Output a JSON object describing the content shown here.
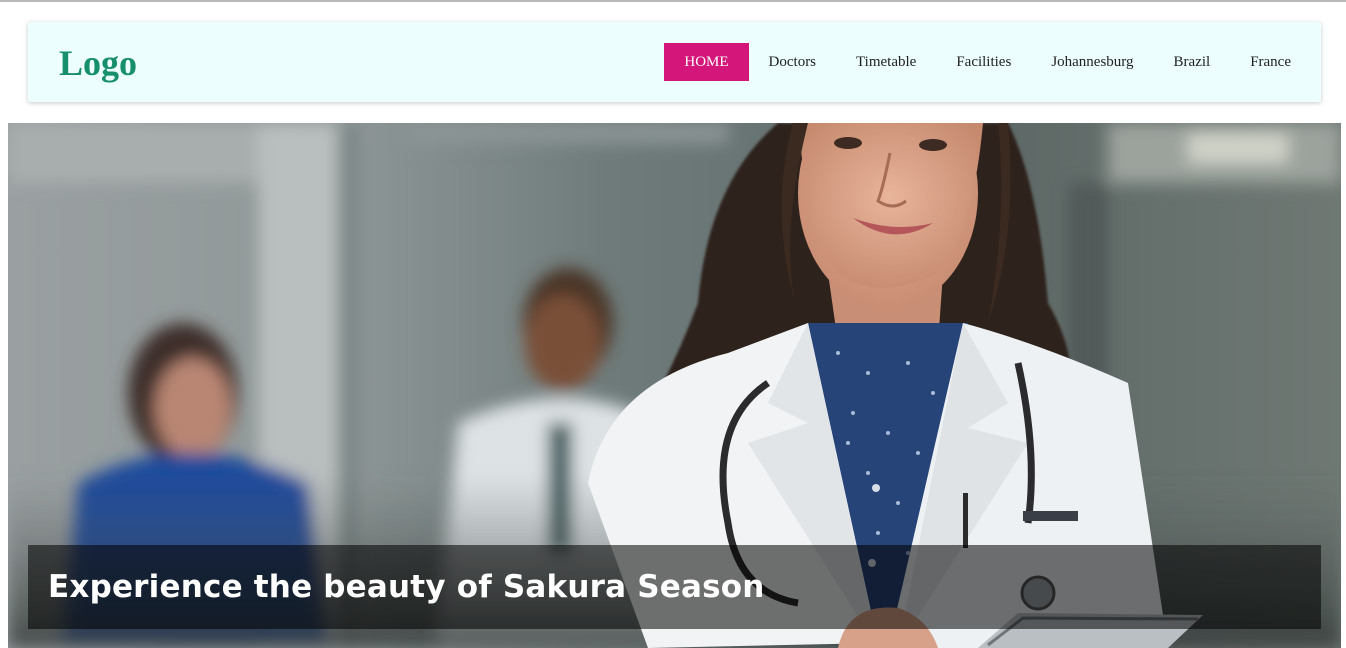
{
  "header": {
    "logo_text": "Logo",
    "nav": [
      {
        "label": "HOME",
        "active": true
      },
      {
        "label": "Doctors",
        "active": false
      },
      {
        "label": "Timetable",
        "active": false
      },
      {
        "label": "Facilities",
        "active": false
      },
      {
        "label": "Johannesburg",
        "active": false
      },
      {
        "label": "Brazil",
        "active": false
      },
      {
        "label": "France",
        "active": false
      }
    ]
  },
  "hero": {
    "image": "doctor-with-tablet-photo",
    "caption": "Experience the beauty of Sakura Season"
  },
  "colors": {
    "logo": "#178f6c",
    "nav_active_bg": "#d4157a",
    "navbar_bg": "#ecfefe"
  }
}
